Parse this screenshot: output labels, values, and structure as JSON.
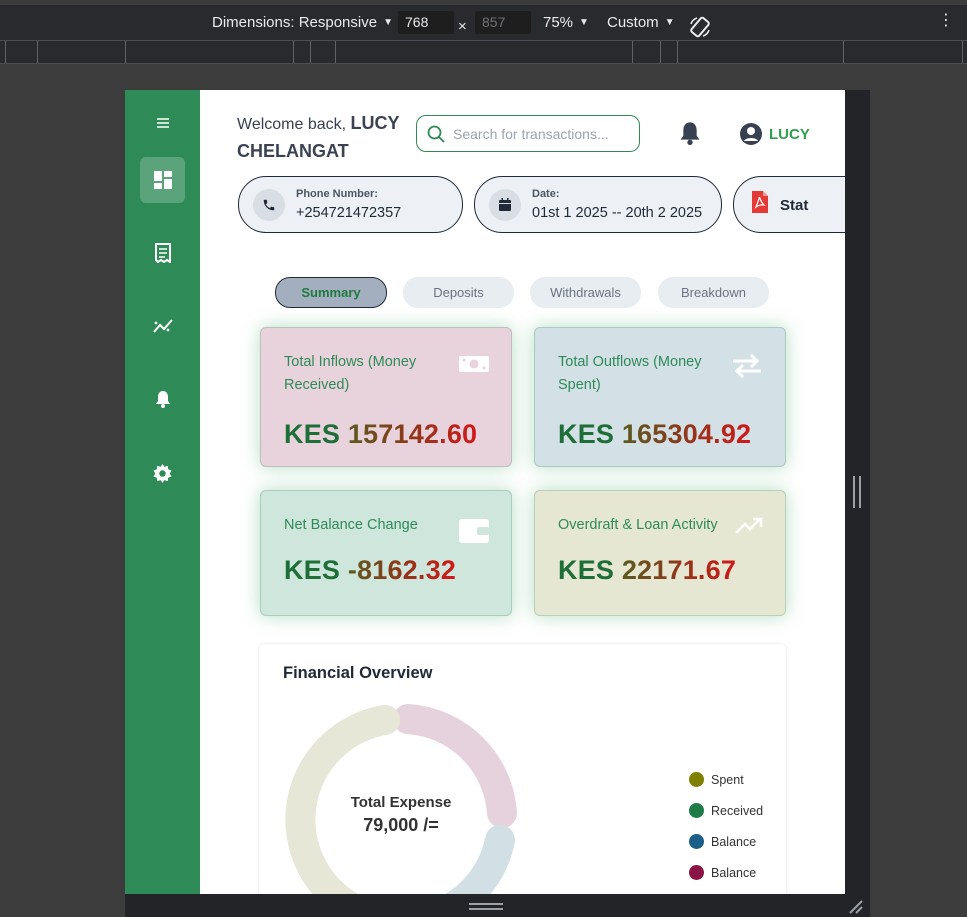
{
  "devtools": {
    "dimensions_label": "Dimensions: Responsive",
    "width": "768",
    "height": "857",
    "zoom": "75%",
    "throttle": "Custom"
  },
  "header": {
    "welcome_prefix": "Welcome back,",
    "user_full_name": "LUCY CHELANGAT",
    "search_placeholder": "Search for transactions...",
    "profile_name": "LUCY"
  },
  "info_pills": [
    {
      "label": "Phone Number:",
      "value": "+254721472357",
      "icon": "phone-icon"
    },
    {
      "label": "Date:",
      "value": "01st 1 2025 -- 20th 2 2025",
      "icon": "calendar-icon"
    },
    {
      "label": "",
      "value": "Stat",
      "icon": "pdf-icon"
    }
  ],
  "tabs": [
    "Summary",
    "Deposits",
    "Withdrawals",
    "Breakdown"
  ],
  "active_tab": "Summary",
  "cards": [
    {
      "title": "Total Inflows (Money Received)",
      "currency": "KES",
      "amount": "157142.60",
      "bg": "#e8d3dc",
      "icon": "cash-icon"
    },
    {
      "title": "Total Outflows (Money Spent)",
      "currency": "KES",
      "amount": "165304.92",
      "bg": "#d3e0e6",
      "icon": "transfer-icon"
    },
    {
      "title": "Net Balance Change",
      "currency": "KES",
      "amount": "-8162.32",
      "bg": "#cfe6dc",
      "icon": "wallet-icon"
    },
    {
      "title": "Overdraft & Loan Activity",
      "currency": "KES",
      "amount": "22171.67",
      "bg": "#e6e7d3",
      "icon": "trending-up-icon"
    }
  ],
  "overview": {
    "title": "Financial Overview",
    "center_label": "Total Expense",
    "center_value": "79,000 /="
  },
  "chart_data": {
    "type": "pie",
    "title": "Financial Overview",
    "series": [
      {
        "name": "Spent",
        "color": "#808000"
      },
      {
        "name": "Received",
        "color": "#1e7a46"
      },
      {
        "name": "Balance",
        "color": "#1b5e8a"
      },
      {
        "name": "Balance",
        "color": "#8a1446"
      }
    ],
    "legend_position": "right"
  },
  "colors": {
    "brand": "#2e8b57",
    "accent_text": "#2e9e4f",
    "negative": "#d21818"
  }
}
